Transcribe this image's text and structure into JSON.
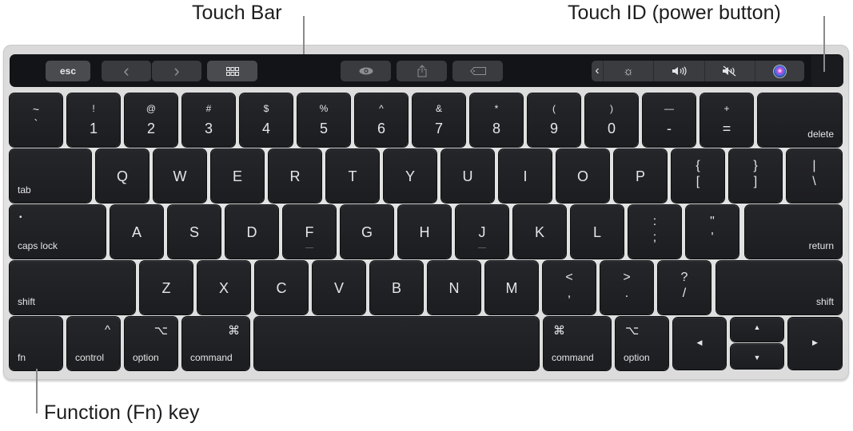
{
  "callouts": {
    "touch_bar": "Touch Bar",
    "touch_id": "Touch ID (power button)",
    "fn_key": "Function (Fn) key"
  },
  "touch_bar": {
    "esc": "esc",
    "back_icon": "‹",
    "forward_icon": "›",
    "mission_control_icon": "▦",
    "quick_look_icon": "◉",
    "share_icon": "⇪",
    "tag_icon": "⌦",
    "expand_icon": "‹",
    "brightness_icon": "☼",
    "volume_icon": "◀))",
    "mute_icon": "◀⃠",
    "siri_icon": "●"
  },
  "rows": {
    "number": [
      {
        "top": "~",
        "bottom": "`"
      },
      {
        "top": "!",
        "bottom": "1"
      },
      {
        "top": "@",
        "bottom": "2"
      },
      {
        "top": "#",
        "bottom": "3"
      },
      {
        "top": "$",
        "bottom": "4"
      },
      {
        "top": "%",
        "bottom": "5"
      },
      {
        "top": "^",
        "bottom": "6"
      },
      {
        "top": "&",
        "bottom": "7"
      },
      {
        "top": "*",
        "bottom": "8"
      },
      {
        "top": "(",
        "bottom": "9"
      },
      {
        "top": ")",
        "bottom": "0"
      },
      {
        "top": "—",
        "bottom": "-"
      },
      {
        "top": "+",
        "bottom": "="
      }
    ],
    "delete": "delete",
    "tab": "tab",
    "qwerty": [
      "Q",
      "W",
      "E",
      "R",
      "T",
      "Y",
      "U",
      "I",
      "O",
      "P"
    ],
    "brackets": [
      {
        "top": "{",
        "bottom": "["
      },
      {
        "top": "}",
        "bottom": "]"
      },
      {
        "top": "|",
        "bottom": "\\"
      }
    ],
    "caps_lock": "caps lock",
    "caps_dot": "•",
    "home": [
      "A",
      "S",
      "D",
      "F",
      "G",
      "H",
      "J",
      "K",
      "L"
    ],
    "home_punct": [
      {
        "top": ":",
        "bottom": ";"
      },
      {
        "top": "\"",
        "bottom": "'"
      }
    ],
    "return": "return",
    "shift_left": "shift",
    "bottom_letters": [
      "Z",
      "X",
      "C",
      "V",
      "B",
      "N",
      "M"
    ],
    "bottom_punct": [
      {
        "top": "<",
        "bottom": ","
      },
      {
        "top": ">",
        "bottom": "."
      },
      {
        "top": "?",
        "bottom": "/"
      }
    ],
    "shift_right": "shift",
    "modifiers": {
      "fn": "fn",
      "control": "control",
      "control_symbol": "^",
      "option": "option",
      "option_symbol": "⌥",
      "command": "command",
      "command_symbol": "⌘"
    },
    "arrows": {
      "left": "◀",
      "up": "▲",
      "down": "▼",
      "right": "▶"
    }
  }
}
